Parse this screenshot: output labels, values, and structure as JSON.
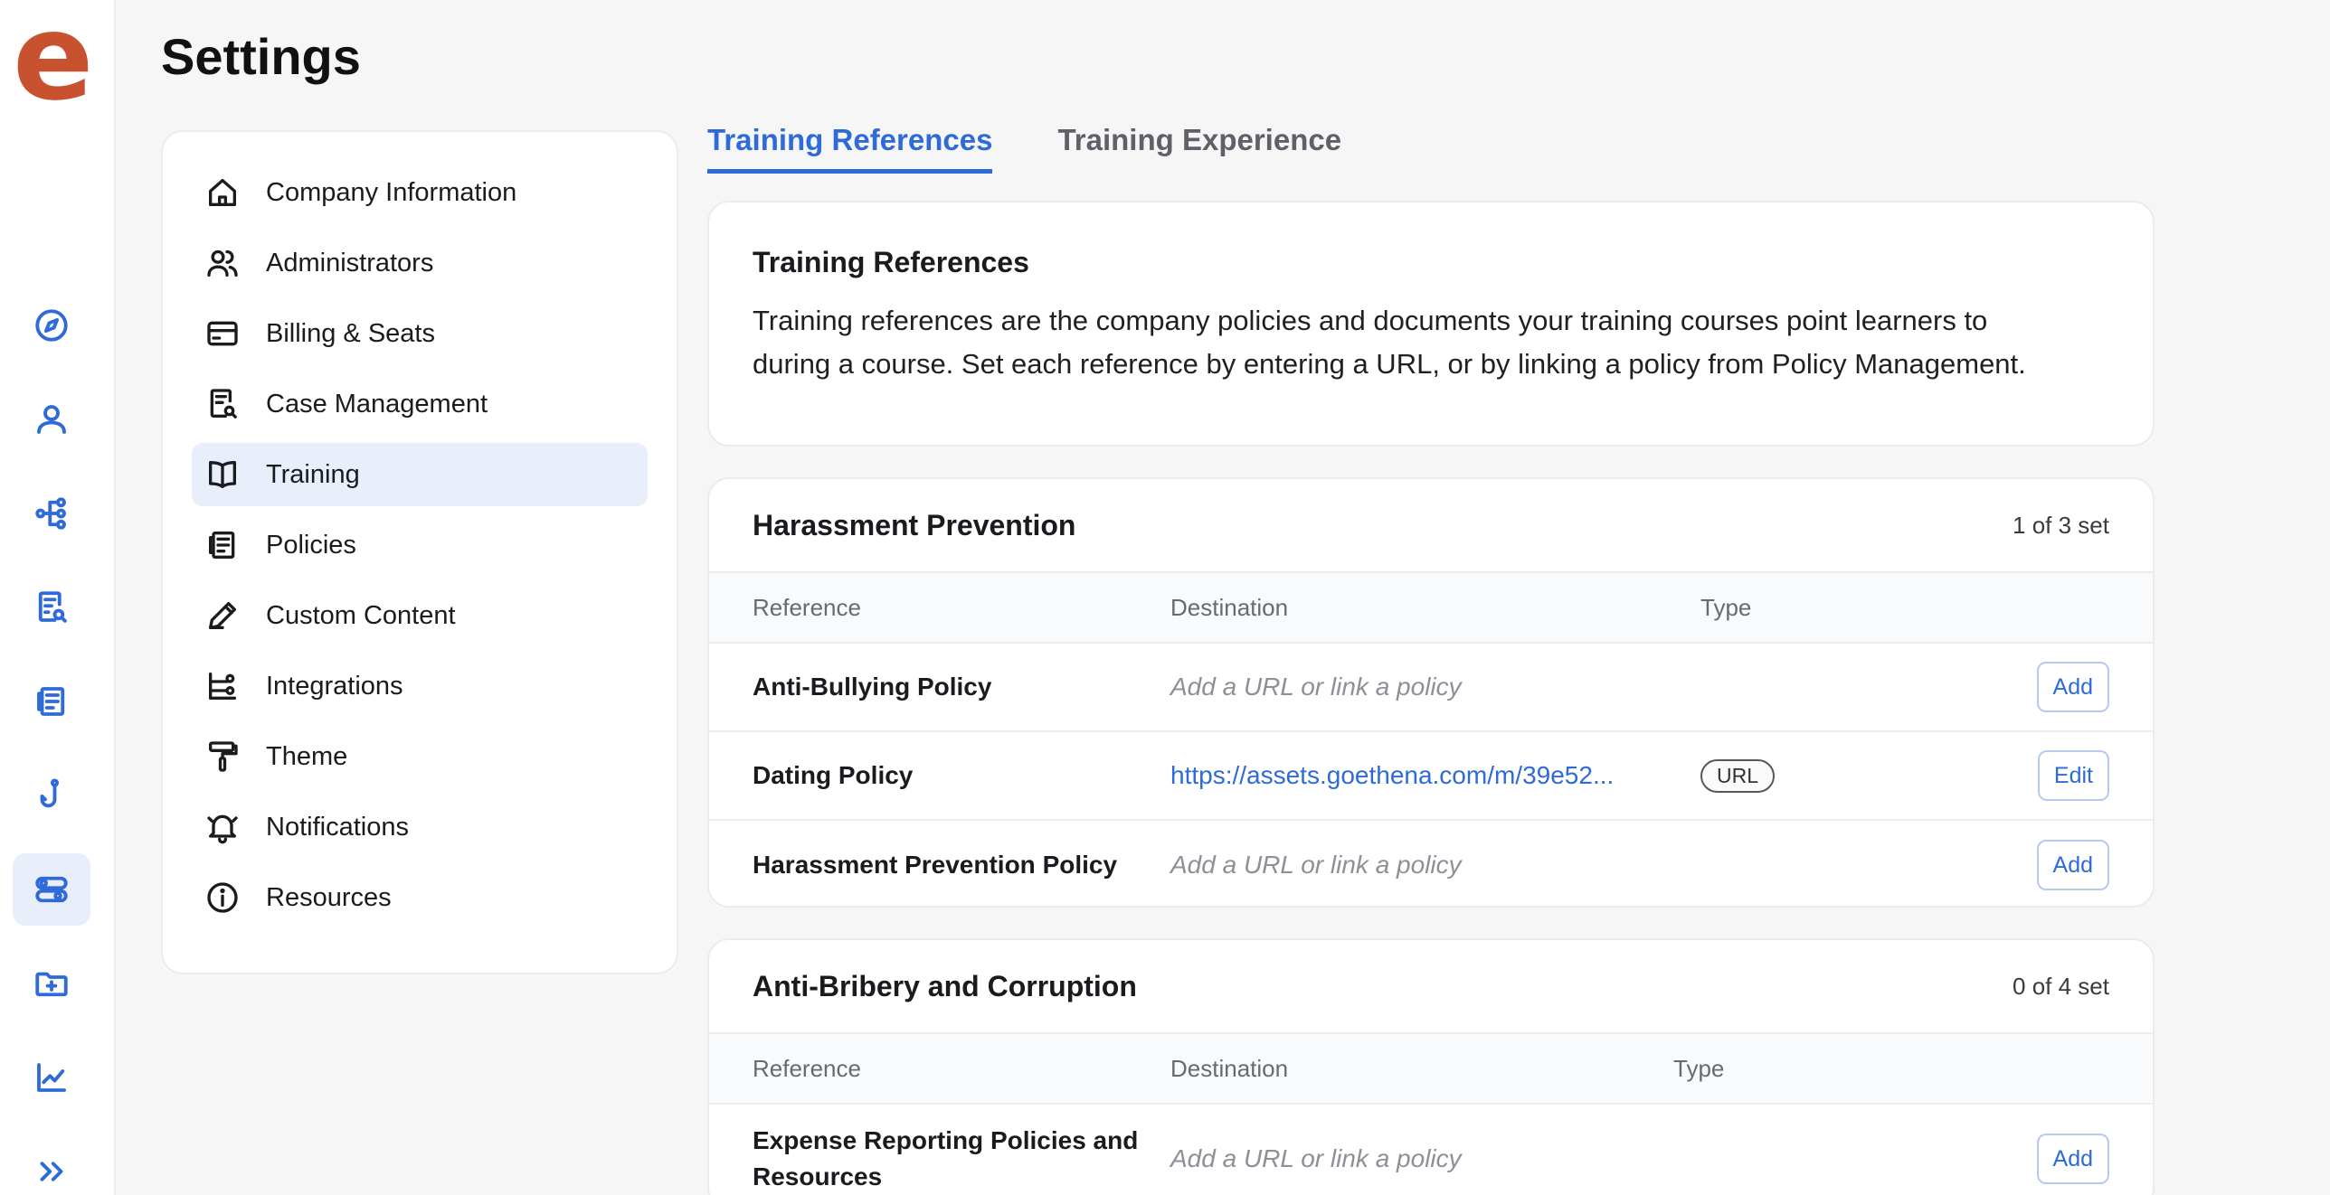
{
  "app": {
    "logo_letter": "e"
  },
  "rail": {
    "icons": [
      "compass-icon",
      "person-icon",
      "org-chart-icon",
      "case-search-icon",
      "policies-icon",
      "hook-icon",
      "settings-toggle-icon",
      "folder-plus-icon",
      "chart-line-icon",
      "expand-icon"
    ]
  },
  "header": {
    "title": "Settings"
  },
  "menu": {
    "items": [
      {
        "label": "Company Information",
        "icon": "home-icon"
      },
      {
        "label": "Administrators",
        "icon": "users-icon"
      },
      {
        "label": "Billing & Seats",
        "icon": "credit-card-icon"
      },
      {
        "label": "Case Management",
        "icon": "case-search-icon"
      },
      {
        "label": "Training",
        "icon": "book-icon",
        "active": true
      },
      {
        "label": "Policies",
        "icon": "policies-icon"
      },
      {
        "label": "Custom Content",
        "icon": "pen-icon"
      },
      {
        "label": "Integrations",
        "icon": "integrations-icon"
      },
      {
        "label": "Theme",
        "icon": "paint-roller-icon"
      },
      {
        "label": "Notifications",
        "icon": "bell-icon"
      },
      {
        "label": "Resources",
        "icon": "info-icon"
      }
    ]
  },
  "tabs": [
    {
      "label": "Training References",
      "active": true
    },
    {
      "label": "Training Experience",
      "active": false
    }
  ],
  "intro": {
    "title": "Training References",
    "text_line1": "Training references are the company policies and documents your training courses point learners to",
    "text_line2": "during a course. Set each reference by entering a URL, or by linking a policy from Policy Management."
  },
  "columns": {
    "reference": "Reference",
    "destination": "Destination",
    "type": "Type"
  },
  "sections": [
    {
      "title": "Harassment Prevention",
      "count": "1 of 3 set",
      "rows": [
        {
          "reference": "Anti-Bullying Policy",
          "destination": "Add a URL or link a policy",
          "type": "",
          "action": "Add"
        },
        {
          "reference": "Dating Policy",
          "destination": "https://assets.goethena.com/m/39e52...",
          "type": "URL",
          "action": "Edit"
        },
        {
          "reference": "Harassment Prevention Policy",
          "destination": "Add a URL or link a policy",
          "type": "",
          "action": "Add"
        }
      ]
    },
    {
      "title": "Anti-Bribery and Corruption",
      "count": "0 of 4 set",
      "rows": [
        {
          "reference": "Expense Reporting Policies and Resources",
          "destination": "Add a URL or link a policy",
          "type": "",
          "action": "Add"
        }
      ]
    }
  ],
  "colors": {
    "accent": "#2f6bd8",
    "logo": "#c8522f",
    "active_bg": "#e9eefb"
  }
}
